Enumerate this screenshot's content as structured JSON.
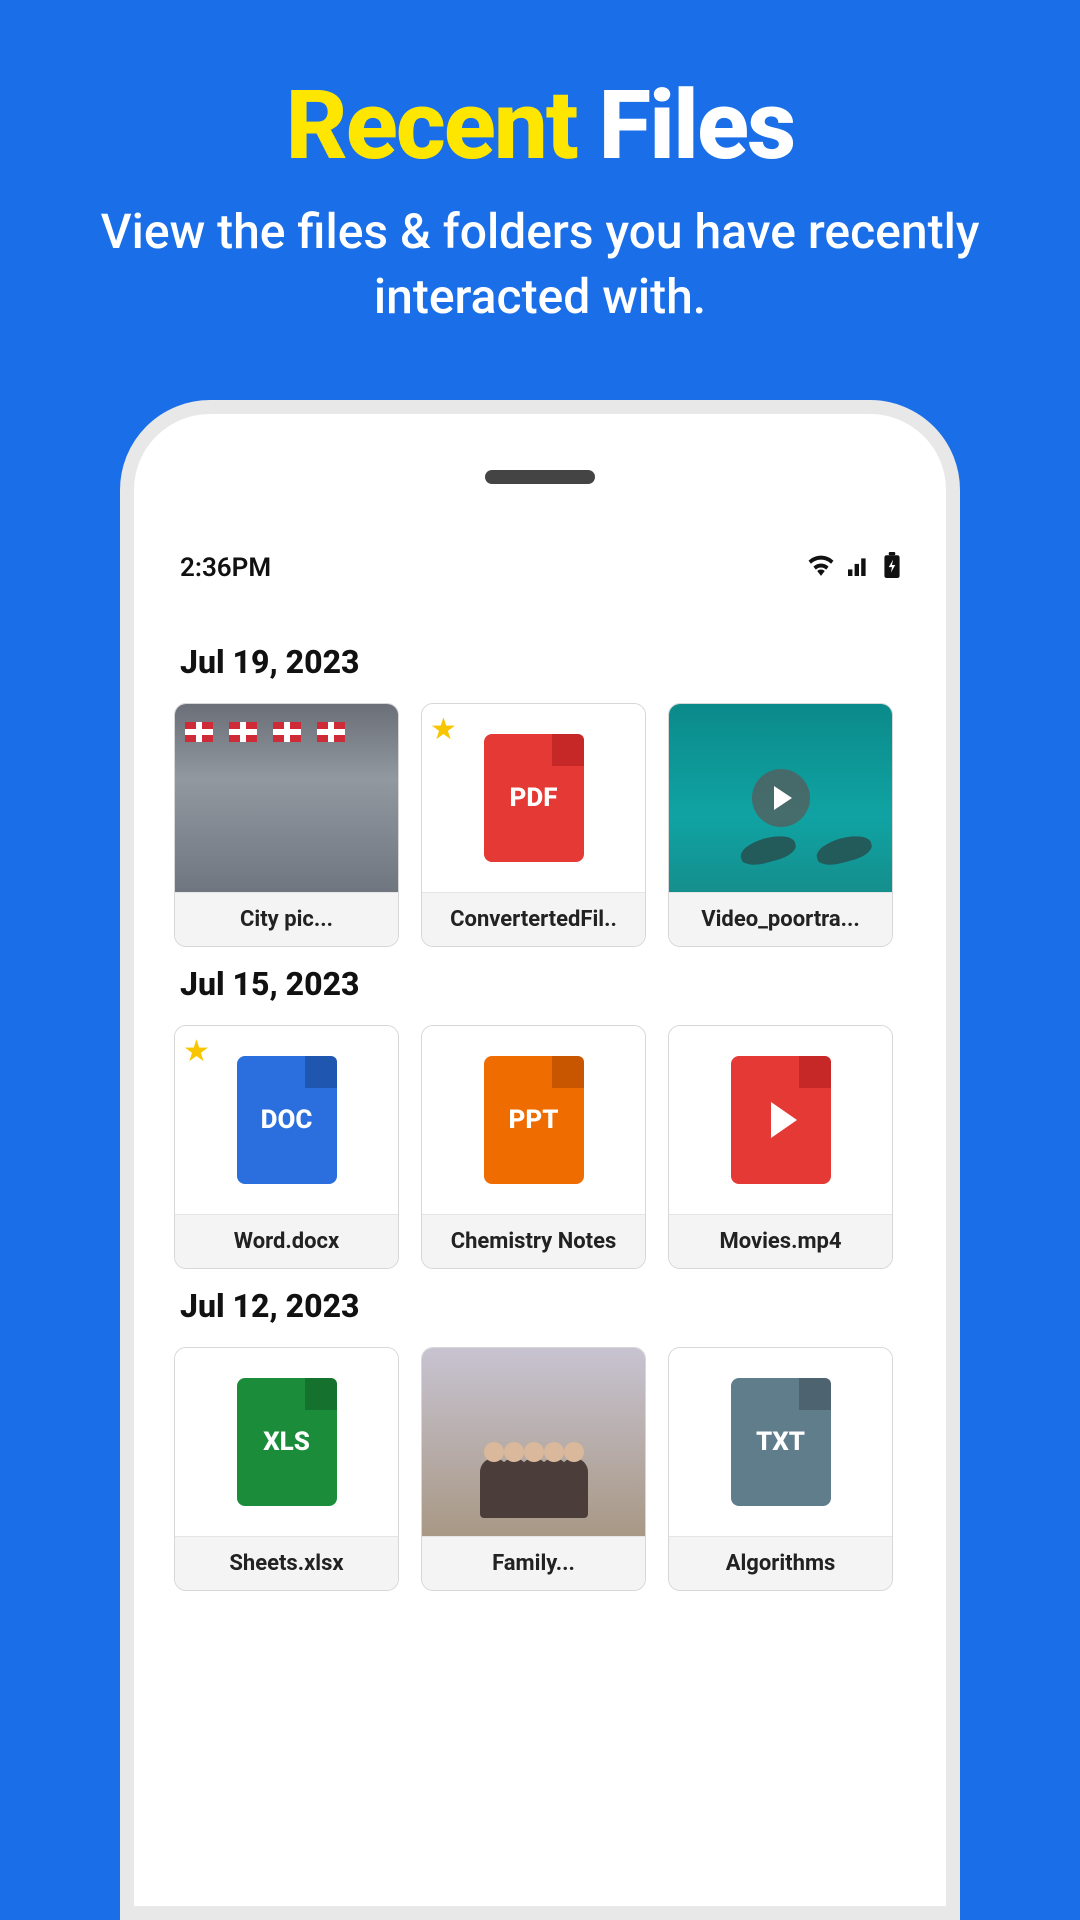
{
  "hero": {
    "title_accent": "Recent",
    "title_rest": "Files",
    "subtitle": "View the files & folders you have recently interacted with."
  },
  "statusbar": {
    "time": "2:36PM"
  },
  "sections": [
    {
      "date": "Jul 19, 2023",
      "files": [
        {
          "name": "City pic...",
          "type": "image",
          "starred": false,
          "thumb": "city"
        },
        {
          "name": "ConvertertedFil..",
          "type": "pdf",
          "starred": true
        },
        {
          "name": "Video_poortra...",
          "type": "video",
          "thumb": "ocean"
        }
      ]
    },
    {
      "date": "Jul 15, 2023",
      "files": [
        {
          "name": "Word.docx",
          "type": "doc",
          "starred": true
        },
        {
          "name": "Chemistry Notes",
          "type": "ppt"
        },
        {
          "name": "Movies.mp4",
          "type": "mp4"
        }
      ]
    },
    {
      "date": "Jul 12, 2023",
      "files": [
        {
          "name": "Sheets.xlsx",
          "type": "xls"
        },
        {
          "name": "Family...",
          "type": "image",
          "thumb": "family"
        },
        {
          "name": "Algorithms",
          "type": "txt"
        }
      ]
    }
  ]
}
